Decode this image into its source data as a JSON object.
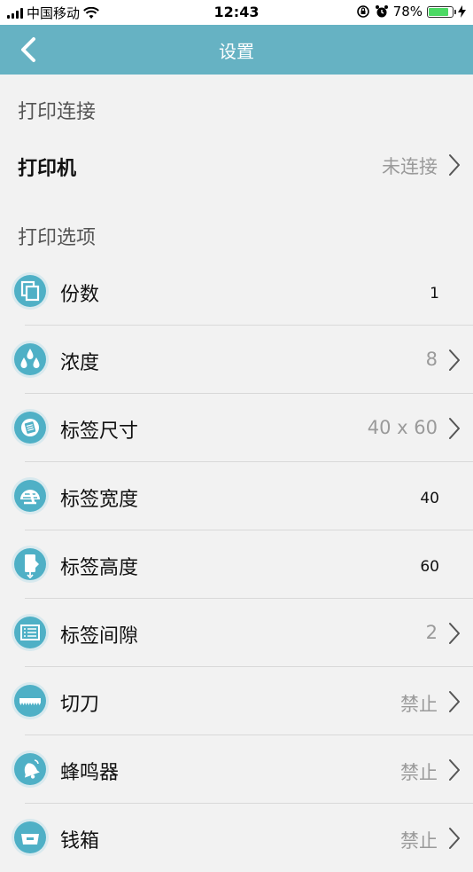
{
  "status_bar": {
    "carrier": "中国移动",
    "time": "12:43",
    "battery": "78%",
    "battery_level": 0.78
  },
  "nav": {
    "title": "设置"
  },
  "sections": {
    "connection_header": "打印连接",
    "options_header": "打印选项"
  },
  "printer": {
    "label": "打印机",
    "value": "未连接"
  },
  "options": [
    {
      "label": "份数",
      "value": "1",
      "icon": "copies-icon"
    },
    {
      "label": "浓度",
      "value": "8",
      "icon": "density-drops-icon"
    },
    {
      "label": "标签尺寸",
      "value": "40 x 60",
      "icon": "label-size-icon"
    },
    {
      "label": "标签宽度",
      "value": "40",
      "icon": "label-width-icon"
    },
    {
      "label": "标签高度",
      "value": "60",
      "icon": "label-height-icon"
    },
    {
      "label": "标签间隙",
      "value": "2",
      "icon": "label-gap-icon"
    },
    {
      "label": "切刀",
      "value": "禁止",
      "icon": "cutter-icon"
    },
    {
      "label": "蜂鸣器",
      "value": "禁止",
      "icon": "buzzer-bell-icon"
    },
    {
      "label": "钱箱",
      "value": "禁止",
      "icon": "cash-drawer-icon"
    }
  ],
  "colors": {
    "nav_bar": "#66b2c3",
    "icon_fill": "#4fb0c6",
    "background": "#f2f2f2"
  }
}
